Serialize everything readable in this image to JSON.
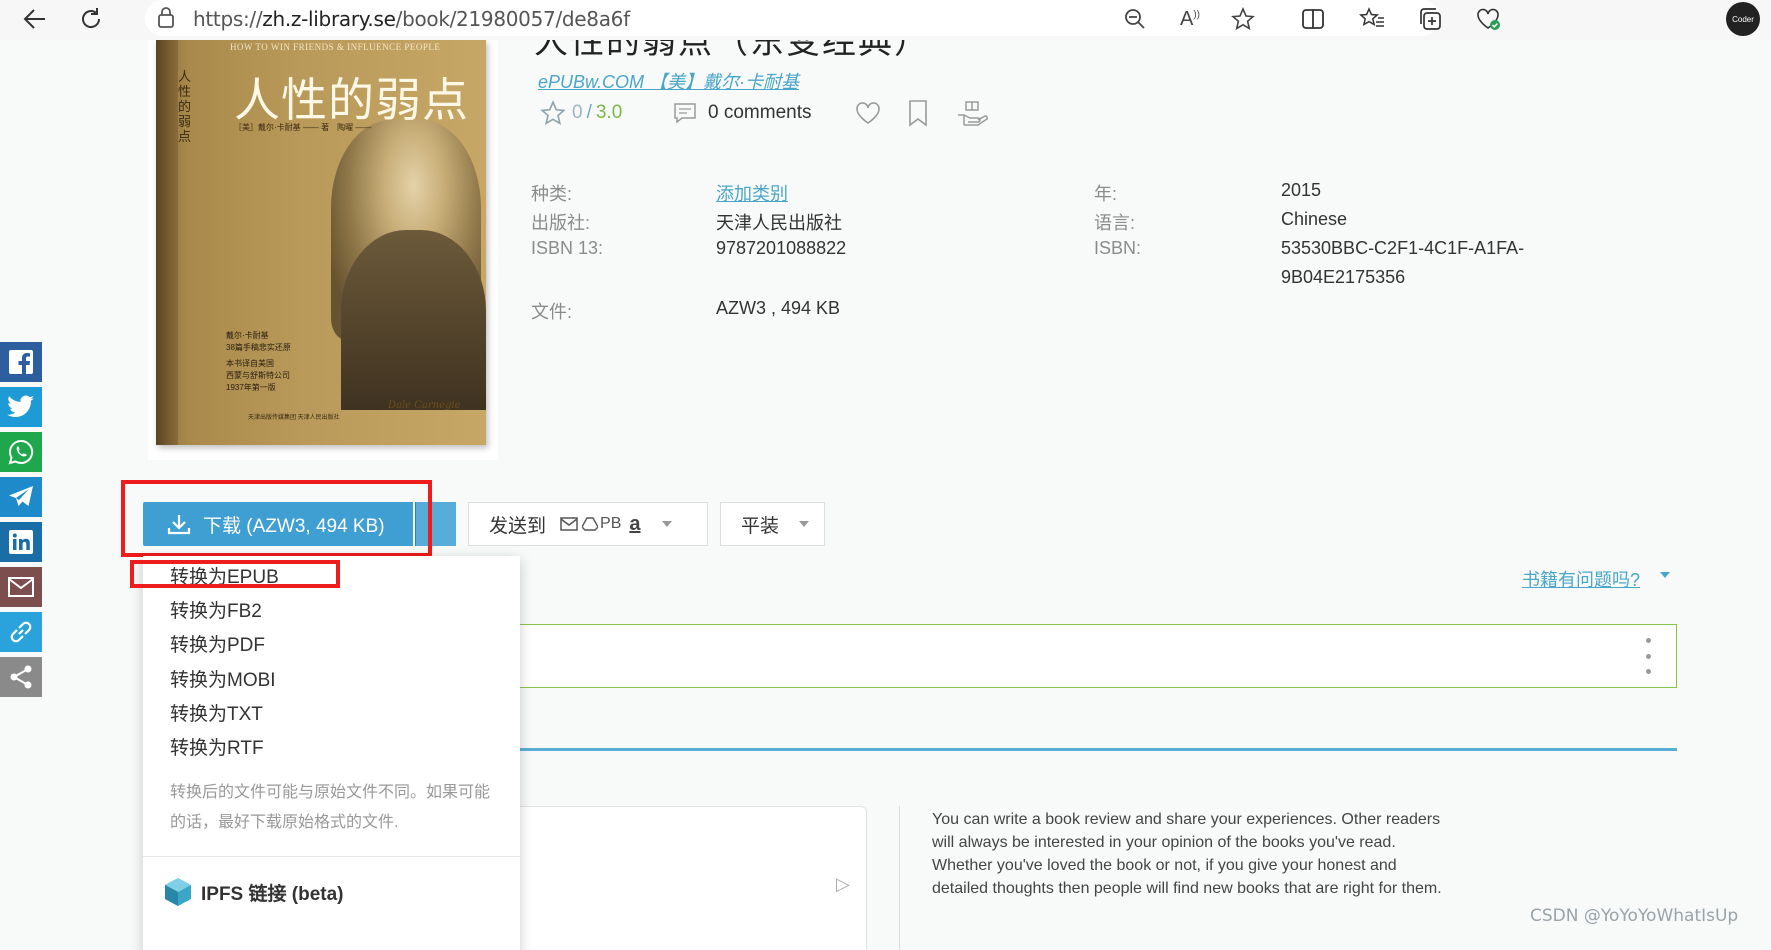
{
  "browser": {
    "url_scheme": "https://",
    "url_host": "zh.z-library.se",
    "url_path": "/book/21980057/de8a6f",
    "avatar_label": "Coder"
  },
  "book": {
    "title_partial": "人性的弱点（东变经典）",
    "author_line": "ePUBw.COM 【美】戴尔·卡耐基",
    "cover": {
      "top_text": "HOW TO WIN FRIENDS & INFLUENCE PEOPLE",
      "title": "人性的弱点",
      "vertical": "人性的弱点",
      "subtitle": "［美］戴尔·卡耐基 —— 著　陶曜 ——",
      "notes": [
        "戴尔·卡耐基",
        "38篇手稿悲实还原",
        "本书译自美国",
        "西蒙与舒斯特公司",
        "1937年第一版"
      ],
      "publisher_logo": "天津出版传媒集团 天津人民出版社"
    },
    "rating": {
      "value": "0",
      "separator": "/",
      "max": "3.0"
    },
    "comments": "0 comments",
    "properties_left": [
      {
        "label": "种类:",
        "value": "添加类别",
        "link": true
      },
      {
        "label": "出版社:",
        "value": "天津人民出版社"
      },
      {
        "label": "ISBN 13:",
        "value": "9787201088822"
      },
      {
        "label": "文件:",
        "value": "AZW3 , 494 KB"
      }
    ],
    "properties_right": [
      {
        "label": "年:",
        "value": "2015"
      },
      {
        "label": "语言:",
        "value": "Chinese"
      },
      {
        "label": "ISBN:",
        "value": "53530BBC-C2F1-4C1F-A1FA-",
        "value2": "9B04E2175356"
      }
    ]
  },
  "actions": {
    "download_label": "下载 (AZW3, 494 KB)",
    "send_to_label": "发送到",
    "send_to_extras": "PB",
    "paperback_label": "平装",
    "problem_link": "书籍有问题吗?"
  },
  "menu": {
    "items": [
      "转换为EPUB",
      "转换为FB2",
      "转换为PDF",
      "转换为MOBI",
      "转换为TXT",
      "转换为RTF"
    ],
    "note": "转换后的文件可能与原始文件不同。如果可能的话，最好下载原始格式的文件.",
    "ipfs_label": "IPFS 链接 (beta)"
  },
  "review": {
    "prompt": "You can write a book review and share your experiences. Other readers will always be interested in your opinion of the books you've read. Whether you've loved the book or not, if you give your honest and detailed thoughts then people will find new books that are right for them."
  },
  "share": [
    "facebook-icon",
    "twitter-icon",
    "whatsapp-icon",
    "telegram-icon",
    "linkedin-icon",
    "email-icon",
    "link-icon",
    "share-icon"
  ],
  "colors": {
    "accent": "#3f9fd2",
    "link": "#4aa6c8",
    "highlight_box": "#ee1c1c",
    "panel_border": "#8bc34a"
  },
  "watermark": "CSDN @YoYoYoWhatIsUp"
}
